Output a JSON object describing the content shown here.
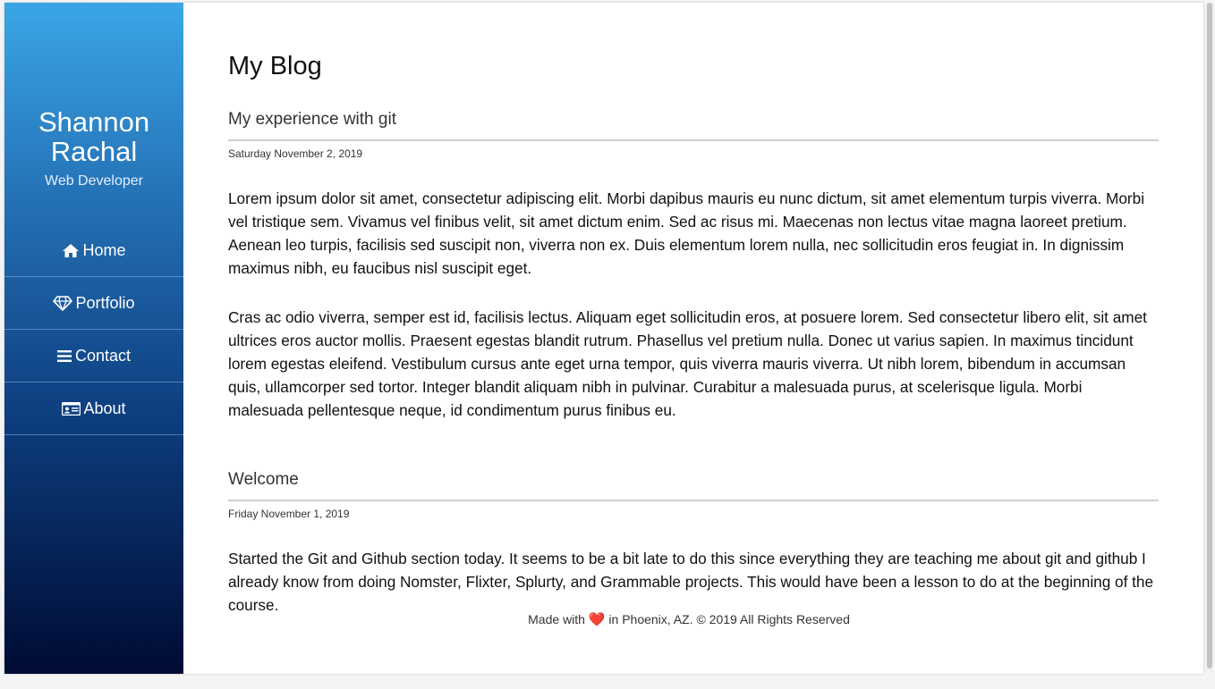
{
  "sidebar": {
    "brand_name": "Shannon Rachal",
    "brand_role": "Web Developer",
    "items": [
      {
        "label": "Home",
        "icon": "home-icon"
      },
      {
        "label": "Portfolio",
        "icon": "diamond-icon"
      },
      {
        "label": "Contact",
        "icon": "bars-icon"
      },
      {
        "label": "About",
        "icon": "id-card-icon"
      }
    ],
    "gradient_colors": [
      "#3aa6e6",
      "#2470b4",
      "#0d3d7e",
      "#000b33"
    ]
  },
  "main": {
    "title": "My Blog",
    "posts": [
      {
        "title": "My experience with git",
        "date": "Saturday November 2, 2019",
        "paragraphs": [
          "Lorem ipsum dolor sit amet, consectetur adipiscing elit. Morbi dapibus mauris eu nunc dictum, sit amet elementum turpis viverra. Morbi vel tristique sem. Vivamus vel finibus velit, sit amet dictum enim. Sed ac risus mi. Maecenas non lectus vitae magna laoreet pretium. Aenean leo turpis, facilisis sed suscipit non, viverra non ex. Duis elementum lorem nulla, nec sollicitudin eros feugiat in. In dignissim maximus nibh, eu faucibus nisl suscipit eget.",
          "Cras ac odio viverra, semper est id, facilisis lectus. Aliquam eget sollicitudin eros, at posuere lorem. Sed consectetur libero elit, sit amet ultrices eros auctor mollis. Praesent egestas blandit rutrum. Phasellus vel pretium nulla. Donec ut varius sapien. In maximus tincidunt lorem egestas eleifend. Vestibulum cursus ante eget urna tempor, quis viverra mauris viverra. Ut nibh lorem, bibendum in accumsan quis, ullamcorper sed tortor. Integer blandit aliquam nibh in pulvinar. Curabitur a malesuada purus, at scelerisque ligula. Morbi malesuada pellentesque neque, id condimentum purus finibus eu."
        ]
      },
      {
        "title": "Welcome",
        "date": "Friday November 1, 2019",
        "paragraphs": [
          "Started the Git and Github section today. It seems to be a bit late to do this since everything they are teaching me about git and github I already know from doing Nomster, Flixter, Splurty, and Grammable projects. This would have been a lesson to do at the beginning of the course."
        ]
      }
    ]
  },
  "footer": {
    "before": "Made with",
    "heart": "❤️",
    "after": "in Phoenix, AZ. © 2019 All Rights Reserved"
  }
}
